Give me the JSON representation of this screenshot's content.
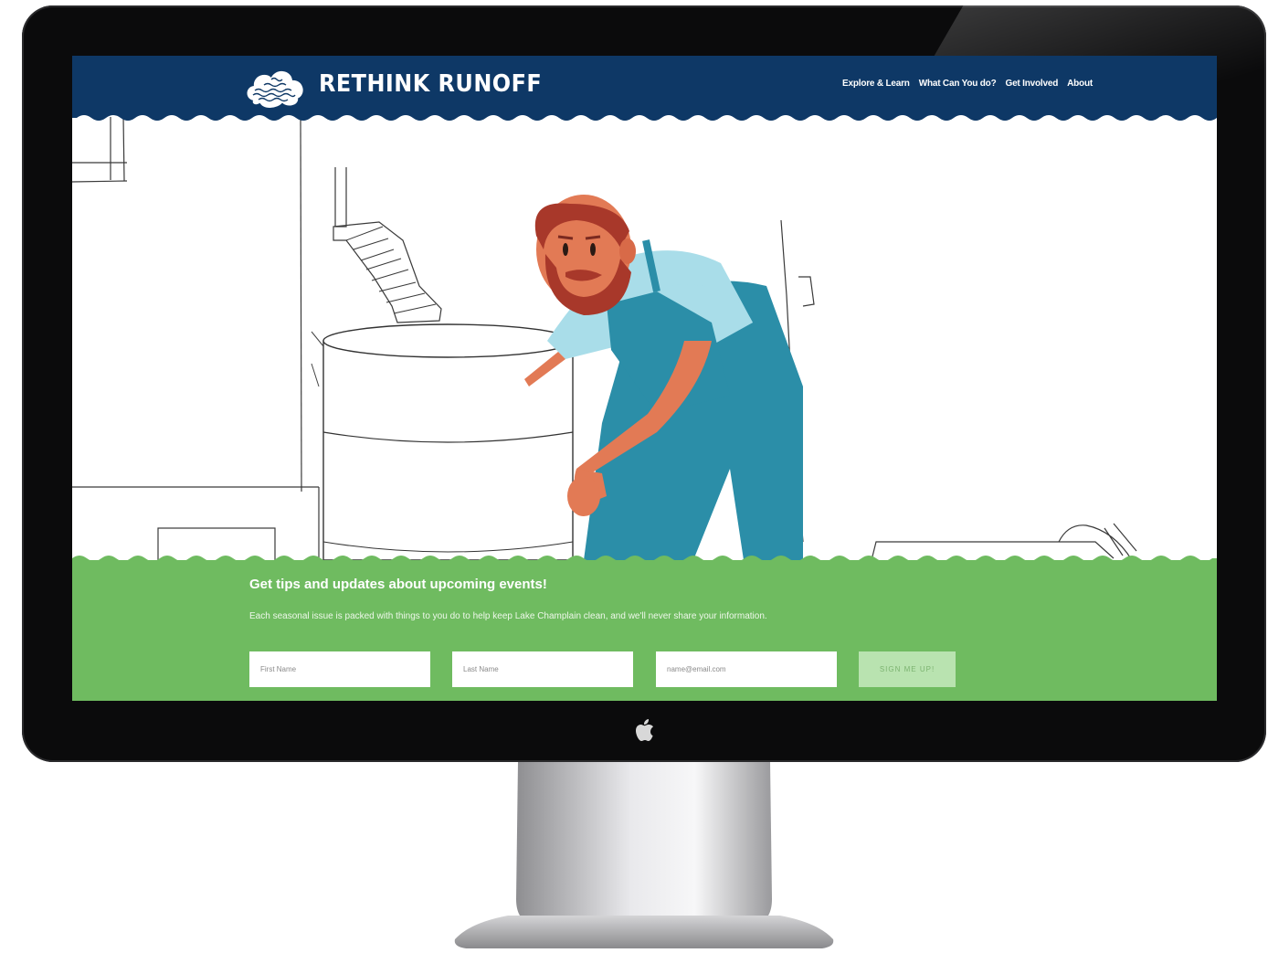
{
  "site": {
    "brand": "RETHINK RUNOFF",
    "nav": [
      {
        "label": "Explore & Learn"
      },
      {
        "label": "What Can You do?"
      },
      {
        "label": "Get Involved"
      },
      {
        "label": "About"
      }
    ]
  },
  "signup": {
    "title": "Get tips and updates about upcoming events!",
    "description": "Each seasonal issue is packed with things to you do to help keep Lake Champlain clean, and we'll never share your information.",
    "first_name_placeholder": "First Name",
    "last_name_placeholder": "Last Name",
    "email_placeholder": "name@email.com",
    "button_label": "SIGN ME UP!"
  },
  "colors": {
    "header_blue": "#0e3866",
    "signup_green": "#6fbb60",
    "button_green": "#b9e3b0",
    "shirt": "#a9dde9",
    "overalls": "#2b8ea8",
    "beard": "#a8382a",
    "skin": "#e27a55"
  },
  "icons": [
    "cloud-logo-icon",
    "apple-logo-icon"
  ]
}
